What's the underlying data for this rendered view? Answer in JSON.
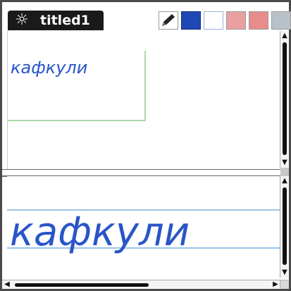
{
  "window": {
    "menu_icon": "sun-icon",
    "title": "titled1"
  },
  "toolbar": {
    "tools": [
      {
        "name": "pen-tool",
        "icon": "pencil-icon"
      },
      {
        "name": "color-blue",
        "icon": "color-swatch-icon",
        "color": "#1e48b4"
      },
      {
        "name": "color-white",
        "icon": "color-swatch-icon",
        "color": "#ffffff"
      },
      {
        "name": "tool-4",
        "icon": "tool-icon"
      },
      {
        "name": "tool-5",
        "icon": "tool-icon"
      },
      {
        "name": "tool-6",
        "icon": "tool-icon"
      }
    ]
  },
  "preview_pane": {
    "ink_text": "кафкули"
  },
  "writing_pane": {
    "ink_text": "кафкули"
  },
  "colors": {
    "ink": "#2a55c8",
    "guide_lines": "#9cc4e8",
    "note_border": "#a8d8a8"
  }
}
